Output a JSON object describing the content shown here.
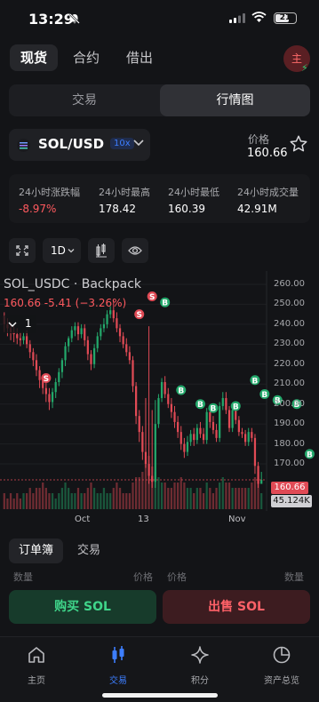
{
  "status": {
    "time": "13:29",
    "battery": "21"
  },
  "top_tabs": [
    {
      "label": "现货",
      "active": true
    },
    {
      "label": "合约",
      "active": false
    },
    {
      "label": "借出",
      "active": false
    }
  ],
  "avatar": {
    "label": "主"
  },
  "segment": {
    "trade": "交易",
    "market": "行情图"
  },
  "pair": {
    "name": "SOL/USD",
    "leverage": "10x"
  },
  "price": {
    "label": "价格",
    "value": "160.66"
  },
  "stats": [
    {
      "label": "24小时涨跌幅",
      "value": "-8.97%"
    },
    {
      "label": "24小时最高",
      "value": "178.42"
    },
    {
      "label": "24小时最低",
      "value": "160.39"
    },
    {
      "label": "24小时成交量",
      "value": "42.91M"
    }
  ],
  "chart_tools": {
    "interval": "1D"
  },
  "chart": {
    "title": "SOL_USDC · Backpack",
    "price_line": "160.66  -5.41 (−3.26%)",
    "mini_select": "1",
    "price_tag": "160.66",
    "volume_tag": "45.124K",
    "y_ticks": [
      "260.00",
      "250.00",
      "240.00",
      "230.00",
      "220.00",
      "210.00",
      "200.00",
      "190.00",
      "180.00",
      "170.00"
    ],
    "x_ticks": [
      "Oct",
      "13",
      "Nov"
    ],
    "colors": {
      "up": "#23a86b",
      "down": "#e04a55",
      "background": "#131417"
    }
  },
  "chart_data": {
    "type": "candlestick",
    "title": "SOL_USDC · Backpack",
    "ylim": [
      158,
      264
    ],
    "x_ticks": [
      "Oct",
      "13",
      "Nov"
    ],
    "candles": [
      [
        244,
        240,
        246,
        236
      ],
      [
        240,
        238,
        243,
        234
      ],
      [
        238,
        236,
        241,
        232
      ],
      [
        236,
        235,
        239,
        231
      ],
      [
        235,
        233,
        238,
        230
      ],
      [
        233,
        232,
        236,
        229
      ],
      [
        232,
        234,
        236,
        230
      ],
      [
        234,
        230,
        237,
        228
      ],
      [
        230,
        226,
        232,
        223
      ],
      [
        226,
        222,
        228,
        219
      ],
      [
        222,
        217,
        225,
        214
      ],
      [
        217,
        212,
        219,
        208
      ],
      [
        212,
        208,
        214,
        205
      ],
      [
        208,
        205,
        212,
        201
      ],
      [
        205,
        201,
        208,
        197
      ],
      [
        201,
        206,
        208,
        198
      ],
      [
        206,
        211,
        213,
        203
      ],
      [
        211,
        216,
        218,
        209
      ],
      [
        216,
        222,
        223,
        213
      ],
      [
        222,
        229,
        231,
        219
      ],
      [
        229,
        233,
        234,
        226
      ],
      [
        233,
        237,
        239,
        231
      ],
      [
        237,
        239,
        241,
        234
      ],
      [
        239,
        235,
        241,
        232
      ],
      [
        235,
        238,
        240,
        233
      ],
      [
        238,
        232,
        240,
        229
      ],
      [
        232,
        225,
        234,
        222
      ],
      [
        225,
        220,
        227,
        217
      ],
      [
        220,
        228,
        230,
        218
      ],
      [
        228,
        234,
        236,
        226
      ],
      [
        234,
        238,
        240,
        232
      ],
      [
        238,
        240,
        243,
        236
      ],
      [
        240,
        245,
        247,
        238
      ],
      [
        245,
        247,
        249,
        243
      ],
      [
        247,
        243,
        252,
        241
      ],
      [
        243,
        238,
        246,
        236
      ],
      [
        238,
        234,
        240,
        231
      ],
      [
        234,
        230,
        236,
        228
      ],
      [
        230,
        226,
        233,
        224
      ],
      [
        226,
        222,
        229,
        220
      ],
      [
        222,
        209,
        224,
        206
      ],
      [
        209,
        194,
        211,
        190
      ],
      [
        194,
        186,
        197,
        181
      ],
      [
        186,
        176,
        189,
        172
      ],
      [
        176,
        170,
        203,
        168
      ],
      [
        170,
        164,
        239,
        160
      ],
      [
        164,
        161,
        197,
        158
      ],
      [
        161,
        190,
        202,
        158
      ],
      [
        190,
        203,
        205,
        188
      ],
      [
        203,
        211,
        213,
        201
      ],
      [
        211,
        205,
        214,
        203
      ],
      [
        205,
        200,
        208,
        198
      ],
      [
        200,
        196,
        203,
        193
      ],
      [
        196,
        191,
        199,
        188
      ],
      [
        191,
        186,
        194,
        183
      ],
      [
        186,
        180,
        189,
        177
      ],
      [
        180,
        176,
        183,
        173
      ],
      [
        176,
        181,
        184,
        174
      ],
      [
        181,
        185,
        187,
        179
      ],
      [
        185,
        182,
        188,
        179
      ],
      [
        182,
        188,
        190,
        180
      ],
      [
        188,
        185,
        191,
        183
      ],
      [
        185,
        182,
        188,
        180
      ],
      [
        182,
        196,
        198,
        180
      ],
      [
        196,
        191,
        199,
        188
      ],
      [
        191,
        187,
        194,
        185
      ],
      [
        187,
        183,
        190,
        181
      ],
      [
        183,
        199,
        201,
        181
      ],
      [
        199,
        203,
        206,
        197
      ],
      [
        203,
        197,
        206,
        195
      ],
      [
        197,
        188,
        199,
        186
      ],
      [
        188,
        197,
        199,
        186
      ],
      [
        197,
        192,
        199,
        190
      ],
      [
        192,
        186,
        194,
        184
      ],
      [
        186,
        185,
        188,
        183
      ],
      [
        185,
        181,
        187,
        179
      ],
      [
        181,
        186,
        188,
        179
      ],
      [
        186,
        183,
        188,
        181
      ],
      [
        183,
        169,
        185,
        165
      ],
      [
        169,
        160,
        171,
        158
      ],
      [
        160,
        162,
        166,
        160
      ]
    ],
    "markers": [
      {
        "kind": "S",
        "at": 13,
        "y": 213
      },
      {
        "kind": "S",
        "at": 42,
        "y": 245
      },
      {
        "kind": "S",
        "at": 46,
        "y": 254
      },
      {
        "kind": "B",
        "at": 50,
        "y": 251
      },
      {
        "kind": "B",
        "at": 55,
        "y": 207
      },
      {
        "kind": "B",
        "at": 61,
        "y": 200
      },
      {
        "kind": "B",
        "at": 65,
        "y": 198
      },
      {
        "kind": "B",
        "at": 72,
        "y": 199
      },
      {
        "kind": "B",
        "at": 78,
        "y": 212
      },
      {
        "kind": "B",
        "at": 81,
        "y": 205
      },
      {
        "kind": "B",
        "at": 85,
        "y": 202
      },
      {
        "kind": "B",
        "at": 91,
        "y": 200
      },
      {
        "kind": "B",
        "at": 95,
        "y": 175
      }
    ],
    "volume": [
      3,
      2,
      3,
      2,
      3,
      2,
      3,
      3,
      4,
      3,
      4,
      4,
      5,
      4,
      3,
      3,
      2,
      3,
      4,
      5,
      4,
      3,
      3,
      4,
      3,
      3,
      4,
      5,
      4,
      3,
      3,
      4,
      3,
      3,
      4,
      5,
      4,
      3,
      3,
      3,
      5,
      6,
      6,
      7,
      9,
      10,
      8,
      7,
      6,
      5,
      5,
      4,
      4,
      5,
      5,
      6,
      5,
      4,
      4,
      3,
      4,
      4,
      3,
      5,
      4,
      3,
      4,
      5,
      6,
      5,
      5,
      4,
      4,
      4,
      4,
      4,
      4,
      5,
      6,
      7,
      3
    ]
  },
  "orderbook": {
    "tabs": [
      "订单簿",
      "交易"
    ],
    "col_left": "数量",
    "col_price": "价格",
    "col_price2": "价格",
    "col_right": "数量"
  },
  "actions": {
    "buy": "购买 SOL",
    "sell": "出售 SOL"
  },
  "nav": [
    {
      "label": "主页",
      "icon": "home-icon",
      "active": false
    },
    {
      "label": "交易",
      "icon": "candles-icon",
      "active": true
    },
    {
      "label": "积分",
      "icon": "sparkle-icon",
      "active": false
    },
    {
      "label": "资产总览",
      "icon": "pie-icon",
      "active": false
    }
  ]
}
